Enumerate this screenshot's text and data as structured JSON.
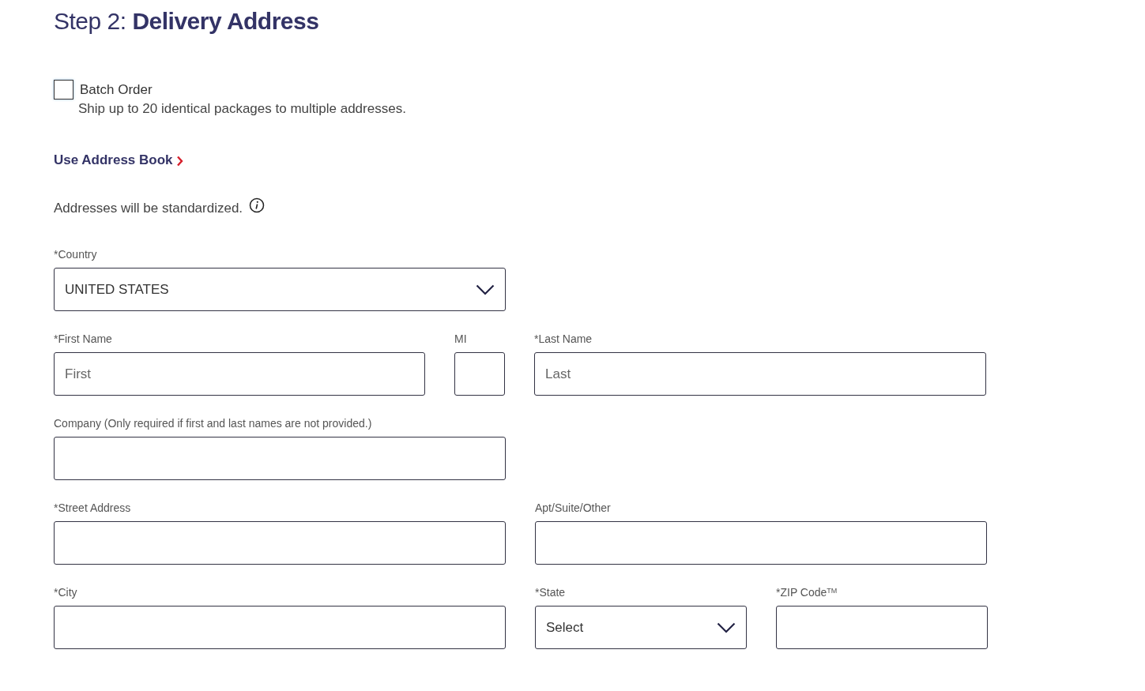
{
  "heading": "Step 2: **Delivery Address**",
  "batch_order": {
    "label": "Batch Order",
    "description": "Ship up to 20 identical packages to multiple addresses.",
    "checked": false
  },
  "address_book_link": {
    "label": "Use Address Book"
  },
  "notice": "Addresses will be standardized.",
  "form_rows": [
    {
      "fields": [
        {
          "kind": "select",
          "label": "*Country",
          "value": "UNITED STATES"
        }
      ]
    },
    {
      "fields": [
        {
          "kind": "input",
          "label": "*First Name",
          "placeholder": "First"
        },
        {
          "kind": "input",
          "label": "MI"
        },
        {
          "kind": "input",
          "label": "*Last Name",
          "placeholder": "Last"
        }
      ]
    },
    {
      "fields": [
        {
          "kind": "input",
          "label": "Company (Only required if first and last names are not provided.)"
        }
      ]
    },
    {
      "fields": [
        {
          "kind": "input",
          "label": "*Street Address"
        },
        {
          "kind": "input",
          "label": "Apt/Suite/Other"
        }
      ]
    },
    {
      "fields": [
        {
          "kind": "input",
          "label": "*City"
        },
        {
          "kind": "select",
          "label": "*State",
          "value": "Select"
        },
        {
          "kind": "input",
          "label": "*ZIP Code$^{TM}$"
        }
      ]
    }
  ]
}
